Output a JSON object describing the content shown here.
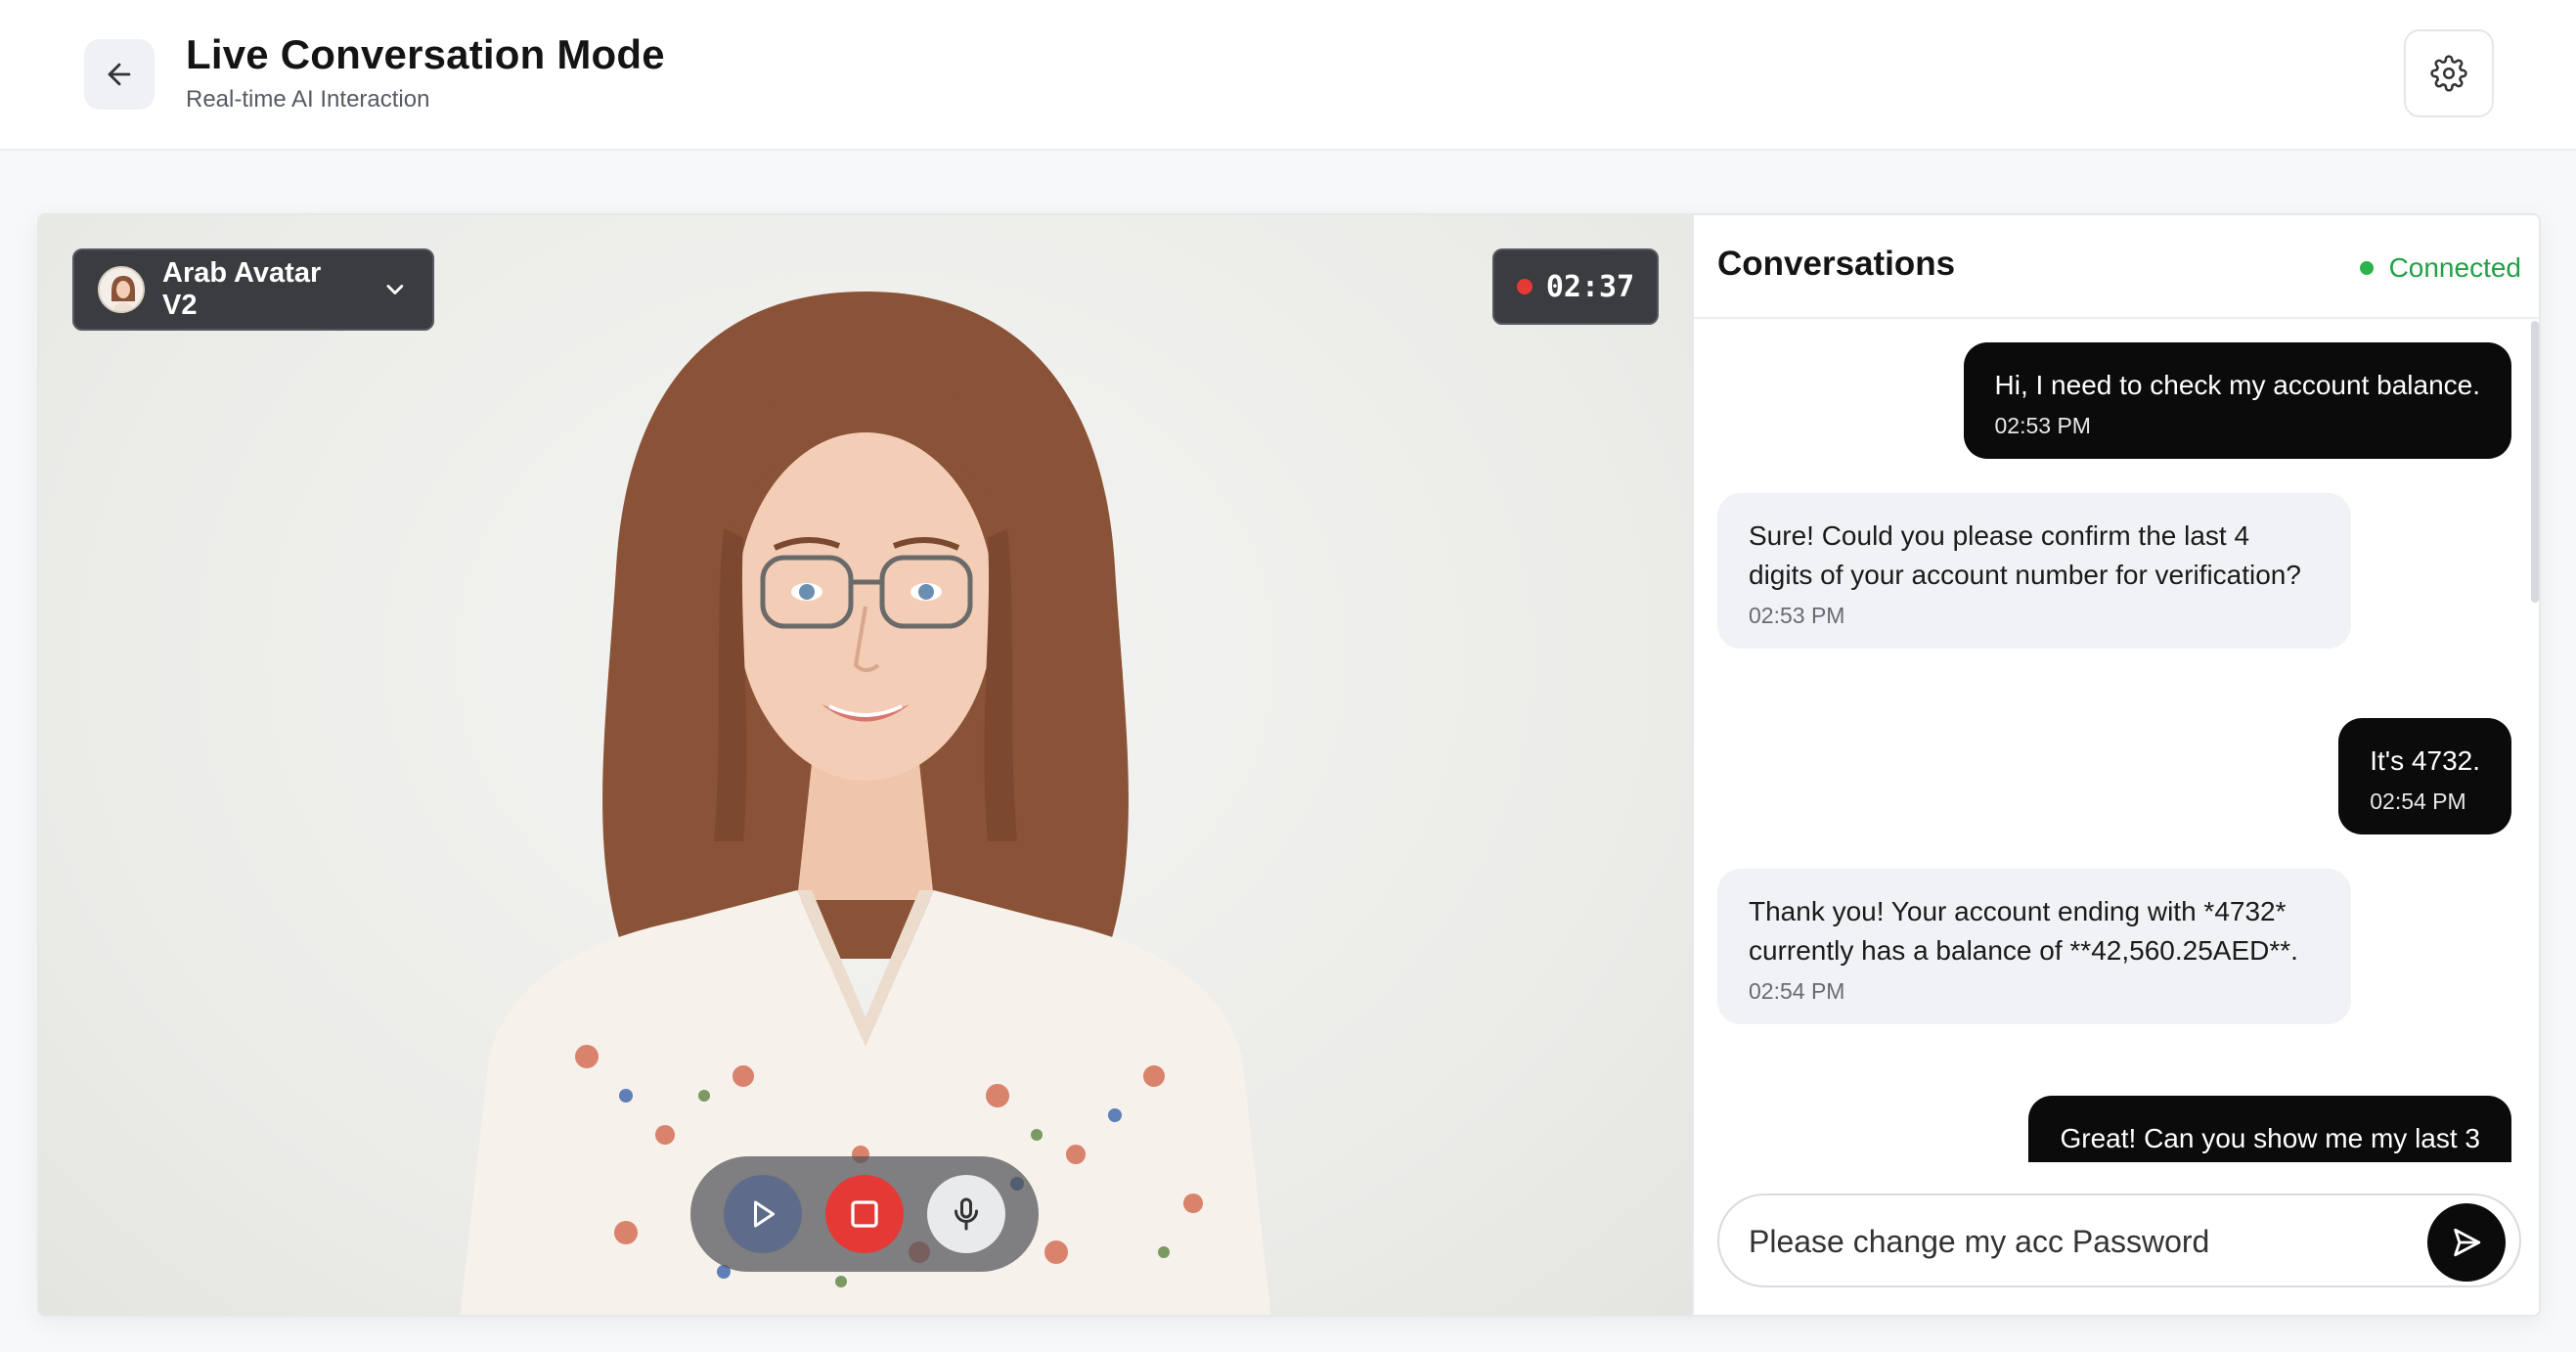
{
  "header": {
    "title": "Live Conversation Mode",
    "subtitle": "Real-time AI Interaction",
    "back_icon": "arrow-left-icon",
    "settings_icon": "gear-icon"
  },
  "video": {
    "avatar_select": {
      "label": "Arab Avatar V2",
      "icon": "chevron-down-icon"
    },
    "timer": "02:37",
    "controls": [
      "play-icon",
      "stop-icon",
      "microphone-icon"
    ]
  },
  "chat": {
    "title": "Conversations",
    "status": "Connected",
    "status_color": "#2bb24c",
    "messages": [
      {
        "role": "user",
        "text": "Hi, I need to check my account balance.",
        "time": "02:53 PM"
      },
      {
        "role": "ai",
        "text": "Sure! Could you please confirm the last 4 digits of your account number for verification?",
        "time": "02:53 PM"
      },
      {
        "role": "user",
        "text": "It's 4732.",
        "time": "02:54 PM"
      },
      {
        "role": "ai",
        "text": "Thank you! Your account ending with *4732* currently has a balance of **42,560.25AED**.",
        "time": "02:54 PM"
      },
      {
        "role": "user",
        "text": "Great! Can you show me my last 3",
        "time": ""
      }
    ],
    "input_value": "Please change my acc Password",
    "send_icon": "send-icon"
  },
  "colors": {
    "accent_dark": "#0b0b0c",
    "record_red": "#e53935",
    "connected_green": "#2bb24c"
  }
}
